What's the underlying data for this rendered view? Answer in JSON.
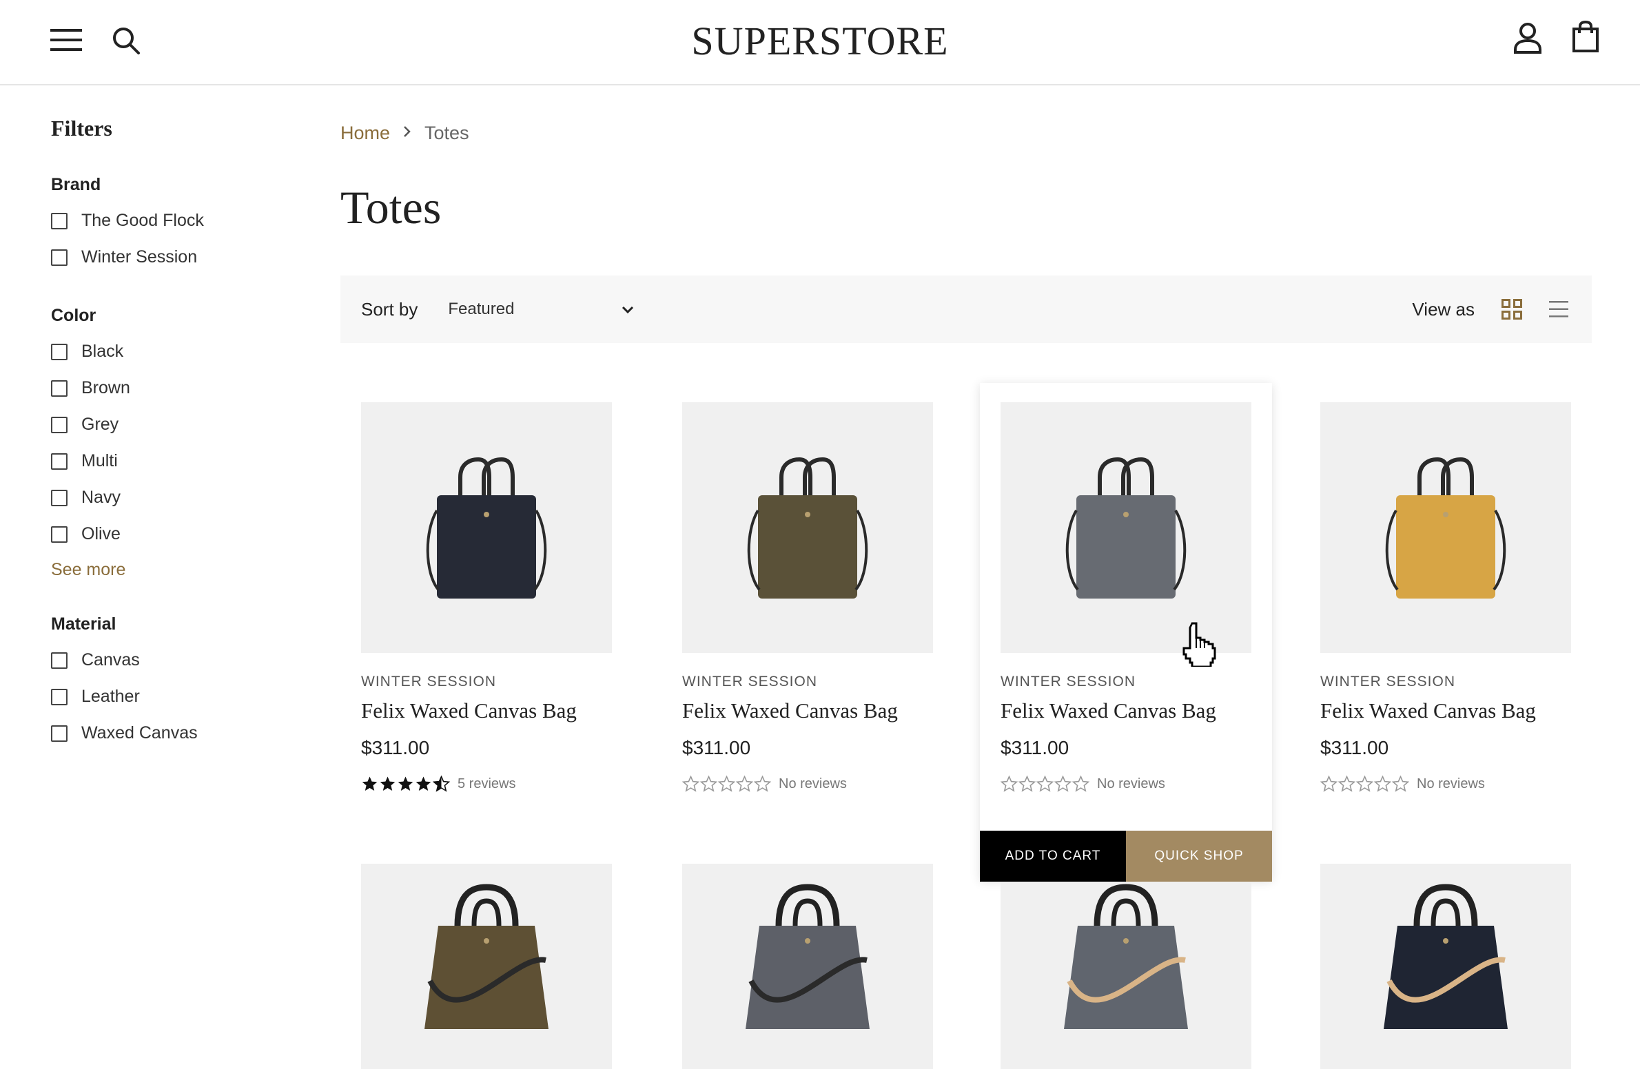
{
  "header": {
    "logo": "SUPERSTORE",
    "icons": [
      "menu-icon",
      "search-icon",
      "account-icon",
      "cart-icon"
    ]
  },
  "sidebar": {
    "title": "Filters",
    "groups": [
      {
        "title": "Brand",
        "items": [
          "The Good Flock",
          "Winter Session"
        ]
      },
      {
        "title": "Color",
        "items": [
          "Black",
          "Brown",
          "Grey",
          "Multi",
          "Navy",
          "Olive"
        ],
        "see_more": "See more"
      },
      {
        "title": "Material",
        "items": [
          "Canvas",
          "Leather",
          "Waxed Canvas"
        ]
      }
    ]
  },
  "breadcrumb": {
    "home": "Home",
    "current": "Totes"
  },
  "page_title": "Totes",
  "toolbar": {
    "sort_label": "Sort by",
    "sort_value": "Featured",
    "view_label": "View as"
  },
  "products": [
    {
      "vendor": "WINTER SESSION",
      "title": "Felix Waxed Canvas Bag",
      "price": "$311.00",
      "rating_text": "5 reviews",
      "rating": 4.5,
      "bag_color": "#262a36"
    },
    {
      "vendor": "WINTER SESSION",
      "title": "Felix Waxed Canvas Bag",
      "price": "$311.00",
      "rating_text": "No reviews",
      "rating": 0,
      "bag_color": "#5a5138"
    },
    {
      "vendor": "WINTER SESSION",
      "title": "Felix Waxed Canvas Bag",
      "price": "$311.00",
      "rating_text": "No reviews",
      "rating": 0,
      "bag_color": "#676b72",
      "add_to_cart": "ADD TO CART",
      "quick_shop": "QUICK SHOP"
    },
    {
      "vendor": "WINTER SESSION",
      "title": "Felix Waxed Canvas Bag",
      "price": "$311.00",
      "rating_text": "No reviews",
      "rating": 0,
      "bag_color": "#d7a545"
    }
  ],
  "products_row2": [
    {
      "bag_color": "#5e5034",
      "strap_color": "#2a2a2a"
    },
    {
      "bag_color": "#5d6068",
      "strap_color": "#2a2a2a"
    },
    {
      "bag_color": "#60656e",
      "strap_color": "#d9b487"
    },
    {
      "bag_color": "#1f2533",
      "strap_color": "#d9b487"
    }
  ],
  "colors": {
    "accent": "#8a6d3b",
    "quick_shop": "#a38a62",
    "toolbar_bg": "#f7f7f7",
    "image_bg": "#f0f0f0"
  }
}
